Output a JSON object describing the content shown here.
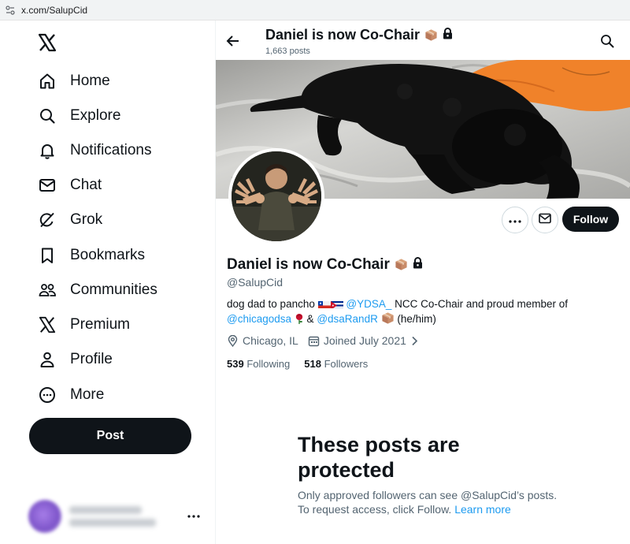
{
  "browser": {
    "url": "x.com/SalupCid"
  },
  "nav": {
    "items": [
      {
        "label": "Home",
        "icon": "home-icon"
      },
      {
        "label": "Explore",
        "icon": "search-icon"
      },
      {
        "label": "Notifications",
        "icon": "bell-icon"
      },
      {
        "label": "Chat",
        "icon": "mail-icon"
      },
      {
        "label": "Grok",
        "icon": "grok-icon"
      },
      {
        "label": "Bookmarks",
        "icon": "bookmark-icon"
      },
      {
        "label": "Communities",
        "icon": "communities-icon"
      },
      {
        "label": "Premium",
        "icon": "x-logo-icon"
      },
      {
        "label": "Profile",
        "icon": "person-icon"
      },
      {
        "label": "More",
        "icon": "more-circle-icon"
      }
    ],
    "post_label": "Post"
  },
  "header": {
    "title": "Daniel is now Co-Chair",
    "post_count": "1,663 posts"
  },
  "profile": {
    "name": "Daniel is now Co-Chair",
    "handle": "@SalupCid",
    "bio": {
      "t1": "dog dad to pancho",
      "link1": "@YDSA_",
      "t2": "NCC Co-Chair and proud member of",
      "link2": "@chicagodsa",
      "t3": "&",
      "link3": "@dsaRandR",
      "t4": "(he/him)"
    },
    "location": "Chicago, IL",
    "joined": "Joined July 2021",
    "following_count": "539",
    "following_label": "Following",
    "followers_count": "518",
    "followers_label": "Followers",
    "follow_label": "Follow"
  },
  "protected": {
    "title": "These posts are protected",
    "line1": "Only approved followers can see @SalupCid’s posts.",
    "line2": "To request access, click Follow.",
    "learn_more": "Learn more"
  },
  "colors": {
    "accent": "#1d9bf0",
    "text": "#0f1419",
    "muted": "#536471",
    "button": "#0f1419"
  }
}
